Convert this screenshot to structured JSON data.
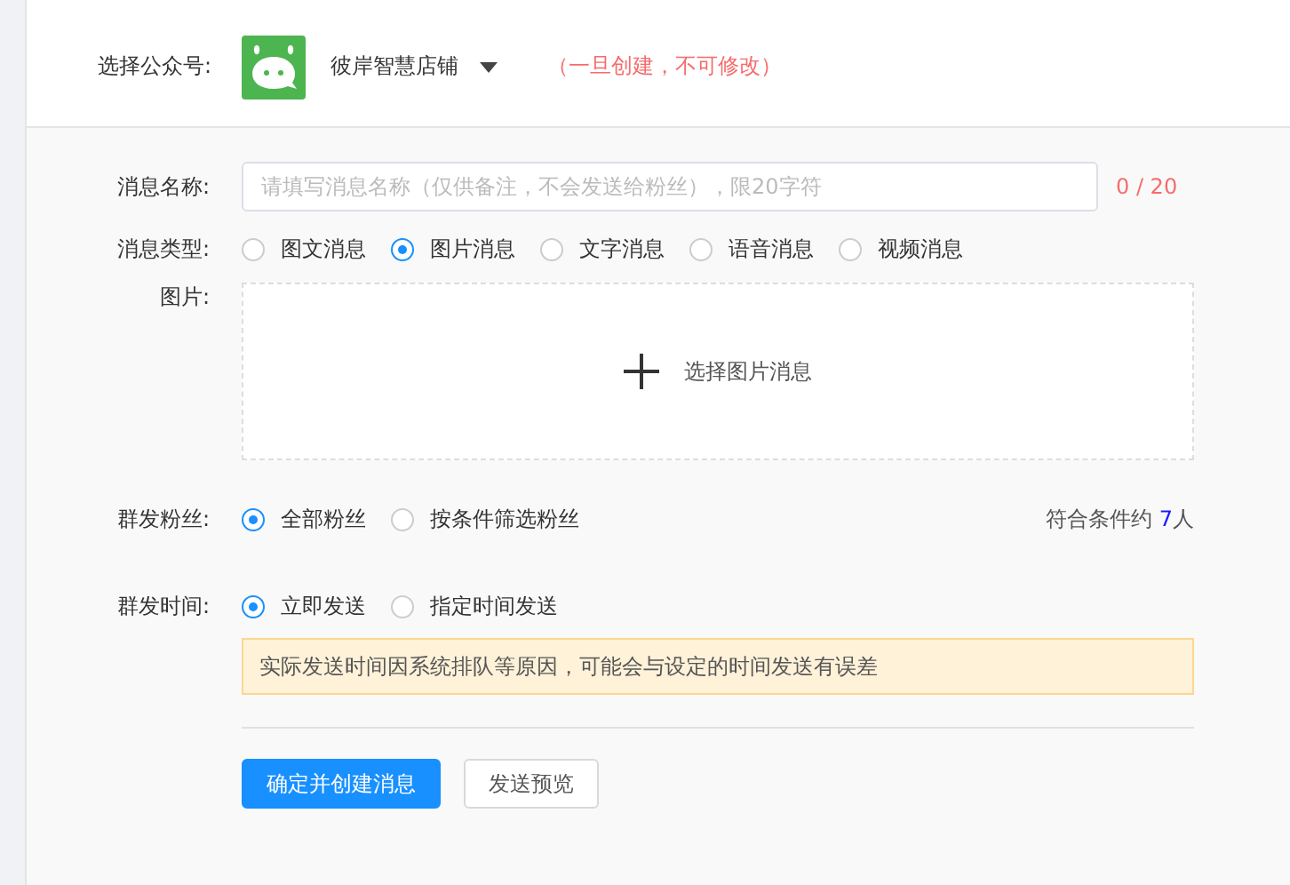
{
  "account": {
    "label": "选择公众号:",
    "name": "彼岸智慧店铺",
    "warning": "（一旦创建，不可修改）"
  },
  "name_field": {
    "label": "消息名称:",
    "placeholder": "请填写消息名称（仅供备注，不会发送给粉丝），限20字符",
    "counter": "0 / 20"
  },
  "message_type": {
    "label": "消息类型:",
    "options": [
      {
        "label": "图文消息",
        "selected": false
      },
      {
        "label": "图片消息",
        "selected": true
      },
      {
        "label": "文字消息",
        "selected": false
      },
      {
        "label": "语音消息",
        "selected": false
      },
      {
        "label": "视频消息",
        "selected": false
      }
    ]
  },
  "image": {
    "label": "图片:",
    "action": "选择图片消息"
  },
  "fans": {
    "label": "群发粉丝:",
    "options": [
      {
        "label": "全部粉丝",
        "selected": true
      },
      {
        "label": "按条件筛选粉丝",
        "selected": false
      }
    ],
    "count_prefix": "符合条件约 ",
    "count": "7",
    "count_suffix": "人"
  },
  "send_time": {
    "label": "群发时间:",
    "options": [
      {
        "label": "立即发送",
        "selected": true
      },
      {
        "label": "指定时间发送",
        "selected": false
      }
    ],
    "notice": "实际发送时间因系统排队等原因，可能会与设定的时间发送有误差"
  },
  "buttons": [
    {
      "label": "确定并创建消息",
      "kind": "primary"
    },
    {
      "label": "发送预览",
      "kind": "default"
    }
  ]
}
